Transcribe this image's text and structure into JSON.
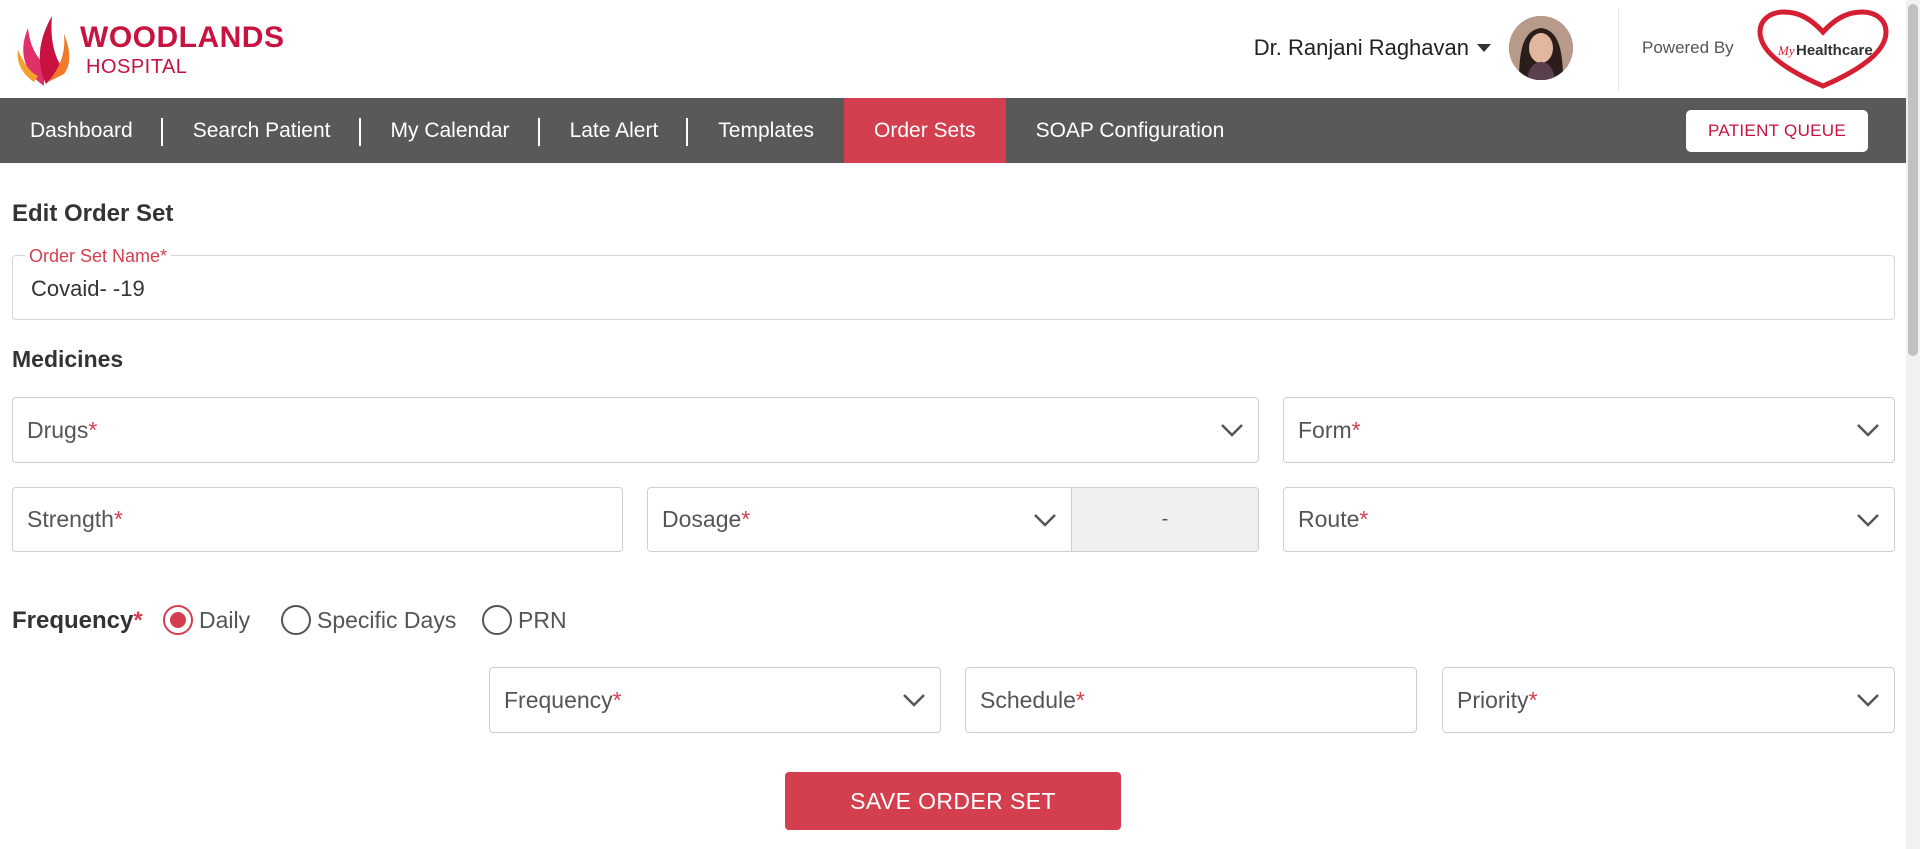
{
  "brand": {
    "name_line1": "WOODLANDS",
    "name_line2": "HOSPITAL",
    "accent_color": "#c8123f"
  },
  "user": {
    "name": "Dr. Ranjani Raghavan",
    "avatar_icon": "user-avatar"
  },
  "powered_by": {
    "label": "Powered By",
    "logo_text_my": "My",
    "logo_text_main": "Healthcare"
  },
  "nav": {
    "items": [
      {
        "label": "Dashboard"
      },
      {
        "label": "Search Patient"
      },
      {
        "label": "My Calendar"
      },
      {
        "label": "Late Alert"
      },
      {
        "label": "Templates"
      },
      {
        "label": "Order Sets",
        "active": true
      },
      {
        "label": "SOAP Configuration"
      }
    ],
    "queue_button": "PATIENT QUEUE",
    "bar_color": "#595959",
    "active_color": "#d43f4f"
  },
  "page": {
    "title": "Edit Order Set",
    "order_set_name_label": "Order Set Name*",
    "order_set_name_value": "Covaid- -19",
    "medicines_title": "Medicines"
  },
  "fields": {
    "drugs": "Drugs",
    "form": "Form",
    "strength": "Strength",
    "dosage": "Dosage",
    "dosage_unit": "-",
    "route": "Route",
    "frequency": "Frequency",
    "schedule": "Schedule",
    "priority": "Priority",
    "required_mark": "*"
  },
  "frequency": {
    "label": "Frequency",
    "options": [
      {
        "label": "Daily",
        "checked": true
      },
      {
        "label": "Specific Days",
        "checked": false
      },
      {
        "label": "PRN",
        "checked": false
      }
    ]
  },
  "actions": {
    "save": "SAVE ORDER SET"
  }
}
